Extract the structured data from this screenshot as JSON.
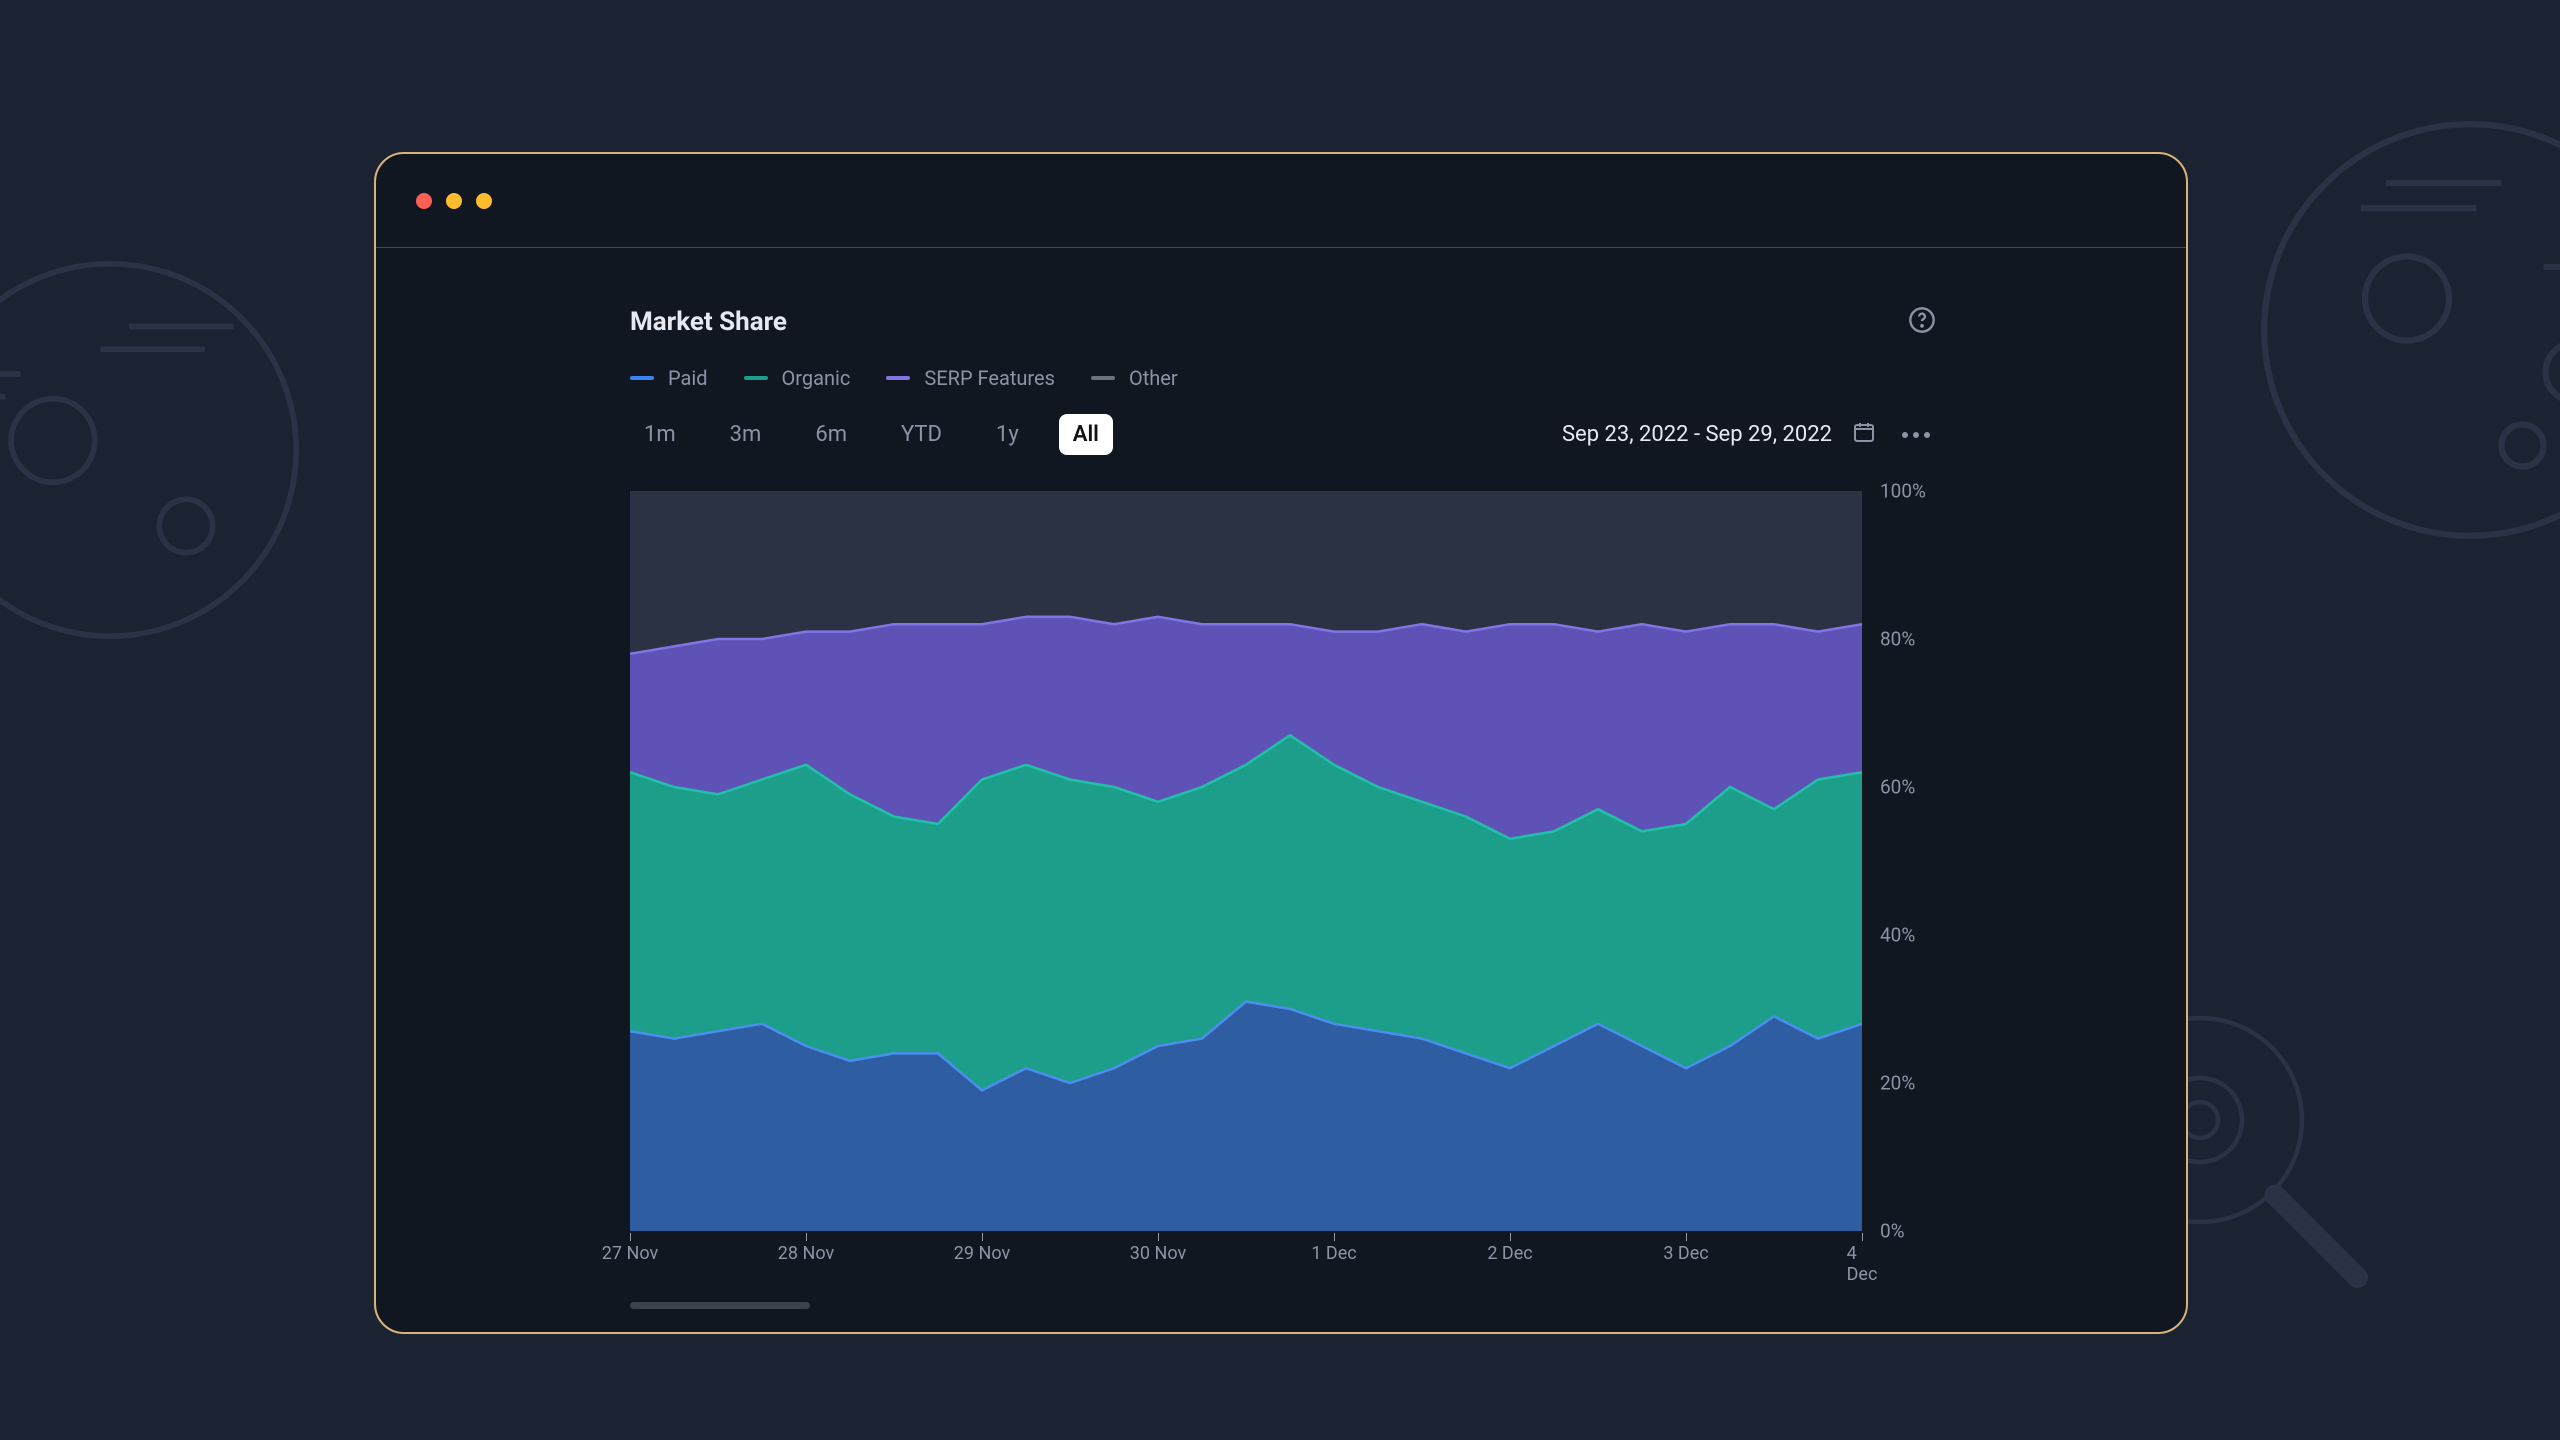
{
  "title": "Market Share",
  "help_icon": "help-circle-icon",
  "legend": [
    {
      "name": "Paid",
      "color": "#3b82f6"
    },
    {
      "name": "Organic",
      "color": "#1c9e8a"
    },
    {
      "name": "SERP Features",
      "color": "#8374e3"
    },
    {
      "name": "Other",
      "color": "#6b7280"
    }
  ],
  "range_buttons": [
    "1m",
    "3m",
    "6m",
    "YTD",
    "1y",
    "All"
  ],
  "range_active": "All",
  "date_range": "Sep 23, 2022 - Sep 29, 2022",
  "y_ticks": [
    "100%",
    "80%",
    "60%",
    "40%",
    "20%",
    "0%"
  ],
  "x_ticks": [
    "27 Nov",
    "28 Nov",
    "29 Nov",
    "30 Nov",
    "1 Dec",
    "2 Dec",
    "3 Dec",
    "4 Dec"
  ],
  "chart_data": {
    "type": "area",
    "stacked": true,
    "title": "Market Share",
    "xlabel": "",
    "ylabel": "",
    "ylim": [
      0,
      100
    ],
    "y_unit": "%",
    "categories": [
      "27 Nov",
      "28 Nov",
      "29 Nov",
      "30 Nov",
      "1 Dec",
      "2 Dec",
      "3 Dec",
      "4 Dec"
    ],
    "series": [
      {
        "name": "Other",
        "color": "#2a3244",
        "cumulative_top": [
          100,
          100,
          100,
          100,
          100,
          100,
          100,
          100,
          100,
          100,
          100,
          100,
          100,
          100,
          100,
          100,
          100,
          100,
          100,
          100,
          100,
          100,
          100,
          100,
          100,
          100,
          100,
          100,
          100
        ]
      },
      {
        "name": "SERP Features",
        "color": "#5f52b6",
        "cumulative_top": [
          78,
          79,
          80,
          80,
          81,
          81,
          82,
          82,
          82,
          83,
          83,
          82,
          83,
          82,
          82,
          82,
          81,
          81,
          82,
          81,
          82,
          82,
          81,
          82,
          81,
          82,
          82,
          81,
          82
        ]
      },
      {
        "name": "Organic",
        "color": "#1c9e8a",
        "cumulative_top": [
          62,
          60,
          59,
          61,
          63,
          59,
          56,
          55,
          61,
          63,
          61,
          60,
          58,
          60,
          63,
          67,
          63,
          60,
          58,
          56,
          53,
          54,
          57,
          54,
          55,
          60,
          57,
          61,
          62
        ]
      },
      {
        "name": "Paid",
        "color": "#2e5ea1",
        "cumulative_top": [
          27,
          26,
          27,
          28,
          25,
          23,
          24,
          24,
          19,
          22,
          20,
          22,
          25,
          26,
          31,
          30,
          28,
          27,
          26,
          24,
          22,
          25,
          28,
          25,
          22,
          25,
          29,
          26,
          28
        ]
      }
    ],
    "series_values_pct": [
      {
        "name": "Paid",
        "values_approx": [
          27,
          26,
          27,
          28,
          25,
          23,
          24,
          24,
          19,
          22,
          20,
          22,
          25,
          26,
          31,
          30,
          28,
          27,
          26,
          24,
          22,
          25,
          28,
          25,
          22,
          25,
          29,
          26,
          28
        ]
      },
      {
        "name": "Organic",
        "values_approx": [
          35,
          34,
          32,
          33,
          38,
          36,
          32,
          31,
          42,
          41,
          41,
          38,
          33,
          34,
          32,
          37,
          35,
          33,
          32,
          32,
          31,
          29,
          29,
          29,
          33,
          35,
          28,
          35,
          34
        ]
      },
      {
        "name": "SERP Features",
        "values_approx": [
          16,
          19,
          21,
          19,
          18,
          22,
          26,
          27,
          21,
          20,
          22,
          22,
          25,
          22,
          19,
          15,
          18,
          21,
          24,
          25,
          29,
          28,
          24,
          28,
          26,
          22,
          25,
          20,
          20
        ]
      },
      {
        "name": "Other",
        "values_approx": [
          22,
          21,
          20,
          20,
          19,
          19,
          18,
          18,
          18,
          17,
          17,
          18,
          17,
          18,
          18,
          18,
          19,
          19,
          18,
          19,
          18,
          18,
          19,
          18,
          19,
          18,
          18,
          19,
          18
        ]
      }
    ]
  }
}
